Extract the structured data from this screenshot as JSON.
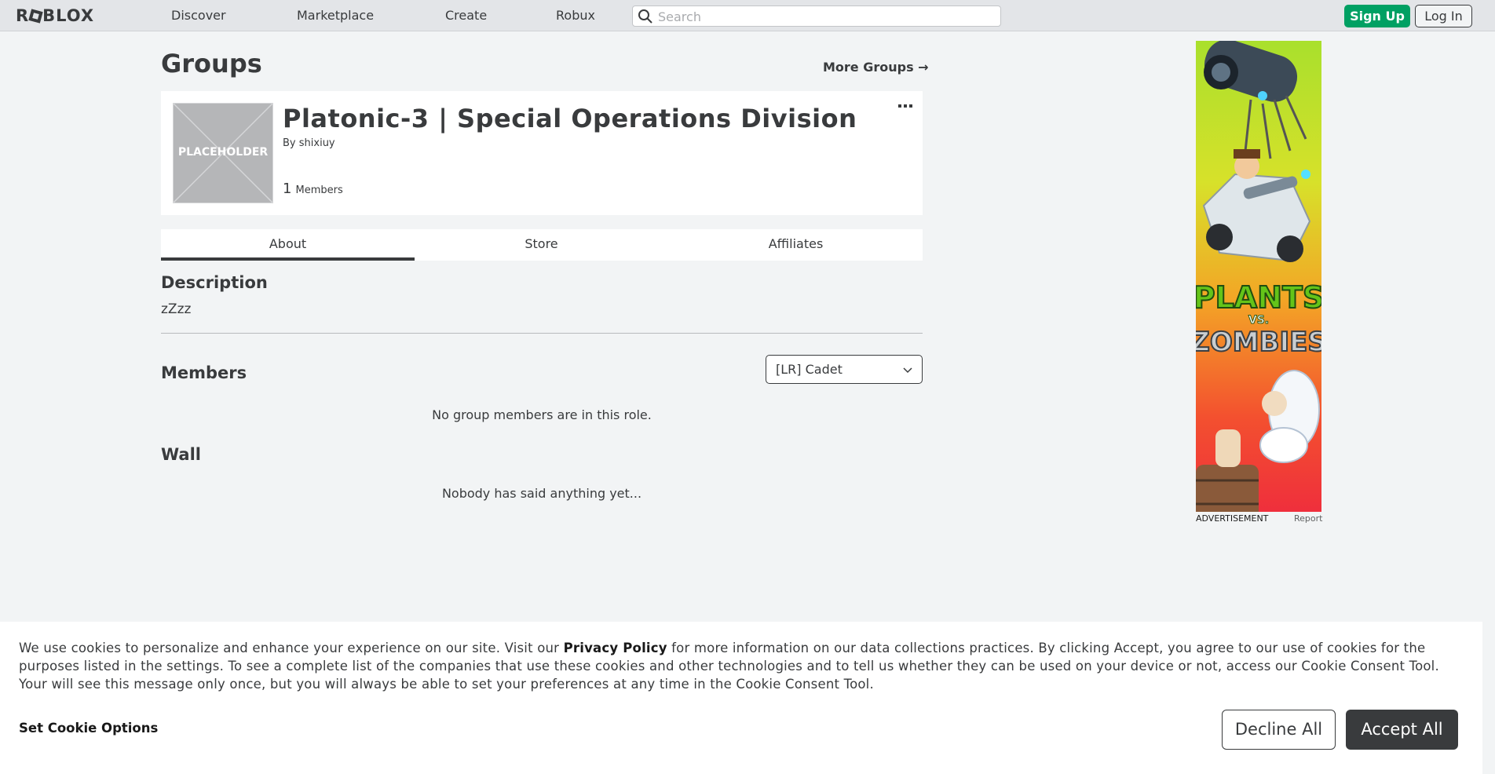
{
  "header": {
    "logo": "ROBLOX",
    "nav": [
      "Discover",
      "Marketplace",
      "Create",
      "Robux"
    ],
    "search_placeholder": "Search",
    "signup_label": "Sign Up",
    "login_label": "Log In"
  },
  "page": {
    "title": "Groups",
    "more_groups": "More Groups →"
  },
  "group": {
    "image_label": "PLACEHOLDER",
    "name": "Platonic-3 | Special Operations Division",
    "by_prefix": "By",
    "owner": "shixiuy",
    "member_count": "1",
    "member_label": "Members"
  },
  "tabs": [
    "About",
    "Store",
    "Affiliates"
  ],
  "about": {
    "description_title": "Description",
    "description_text": "zZzz",
    "members_title": "Members",
    "role_selected": "[LR] Cadet",
    "members_empty": "No group members are in this role.",
    "wall_title": "Wall",
    "wall_empty": "Nobody has said anything yet..."
  },
  "ad": {
    "brand_line1": "PLANTS",
    "brand_vs": "VS.",
    "brand_line2": "ZOMBIES",
    "label": "ADVERTISEMENT",
    "report": "Report"
  },
  "cookie": {
    "text_before": "We use cookies to personalize and enhance your experience on our site. Visit our ",
    "privacy_link": "Privacy Policy",
    "text_after": " for more information on our data collections practices. By clicking Accept, you agree to our use of cookies for the purposes listed in the settings. To see a complete list of the companies that use these cookies and other technologies and to tell us whether they can be used on your device or not, access our Cookie Consent Tool. Your will see this message only once, but you will always be able to set your preferences at any time in the Cookie Consent Tool.",
    "options_label": "Set Cookie Options",
    "decline_label": "Decline All",
    "accept_label": "Accept All"
  },
  "colors": {
    "signup": "#00a063",
    "accept": "#393b3d",
    "background": "#f2f4f5"
  }
}
